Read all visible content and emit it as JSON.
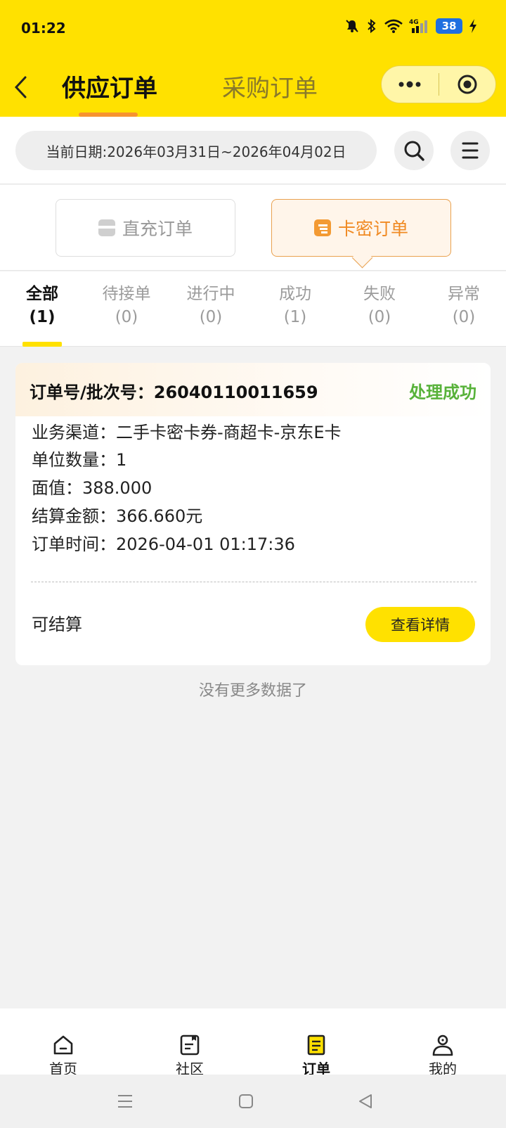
{
  "status_bar": {
    "time": "01:22",
    "battery": "38",
    "network": "4G"
  },
  "header": {
    "tabs": [
      {
        "label": "供应订单",
        "active": true
      },
      {
        "label": "采购订单",
        "active": false
      }
    ],
    "accent_color": "#ffe100",
    "underline_color": "#f7932f"
  },
  "date_filter": {
    "label": "当前日期:2026年03月31日~2026年04月02日"
  },
  "order_types": [
    {
      "label": "直充订单",
      "active": false
    },
    {
      "label": "卡密订单",
      "active": true
    }
  ],
  "status_tabs": [
    {
      "label": "全部",
      "count": "(1)",
      "active": true
    },
    {
      "label": "待接单",
      "count": "(0)"
    },
    {
      "label": "进行中",
      "count": "(0)"
    },
    {
      "label": "成功",
      "count": "(1)"
    },
    {
      "label": "失败",
      "count": "(0)"
    },
    {
      "label": "异常",
      "count": "(0)"
    }
  ],
  "order": {
    "number": "订单号/批次号：26040110011659",
    "status": "处理成功",
    "status_color": "#58b23a",
    "fields": [
      "业务渠道：二手卡密卡券-商超卡-京东E卡",
      "单位数量：1",
      "面值：388.000",
      "结算金额：366.660元",
      "订单时间：2026-04-01 01:17:36"
    ],
    "settle_status": "可结算",
    "detail_button": "查看详情"
  },
  "no_more_text": "没有更多数据了",
  "bottom_nav": [
    {
      "label": "首页",
      "icon": "home-icon"
    },
    {
      "label": "社区",
      "icon": "community-icon"
    },
    {
      "label": "订单",
      "icon": "order-icon",
      "active": true
    },
    {
      "label": "我的",
      "icon": "profile-icon"
    }
  ]
}
